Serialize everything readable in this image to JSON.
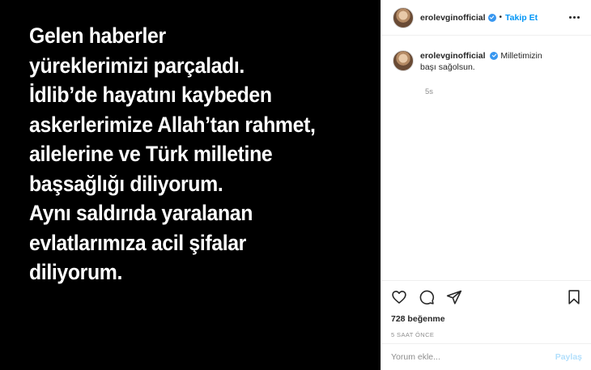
{
  "post": {
    "lines": [
      "Gelen haberler",
      "yüreklerimizi parçaladı.",
      "İdlib’de hayatını kaybeden",
      "askerlerimize Allah’tan rahmet,",
      "ailelerine ve Türk milletine",
      "başsağlığı diliyorum.",
      "Aynı saldırıda yaralanan",
      "evlatlarımıza acil şifalar",
      "diliyorum."
    ]
  },
  "header": {
    "username": "erolevginofficial",
    "separator": "•",
    "follow_label": "Takip Et"
  },
  "caption": {
    "username": "erolevginofficial",
    "text": "Milletimizin başı sağolsun.",
    "time": "5s"
  },
  "actions": {
    "likes": "728 beğenme",
    "post_time": "5 SAAT ÖNCE"
  },
  "comment": {
    "placeholder": "Yorum ekle...",
    "share_label": "Paylaş"
  },
  "colors": {
    "accent": "#0095f6",
    "verified": "#3897f0",
    "muted": "#8e8e8e"
  }
}
